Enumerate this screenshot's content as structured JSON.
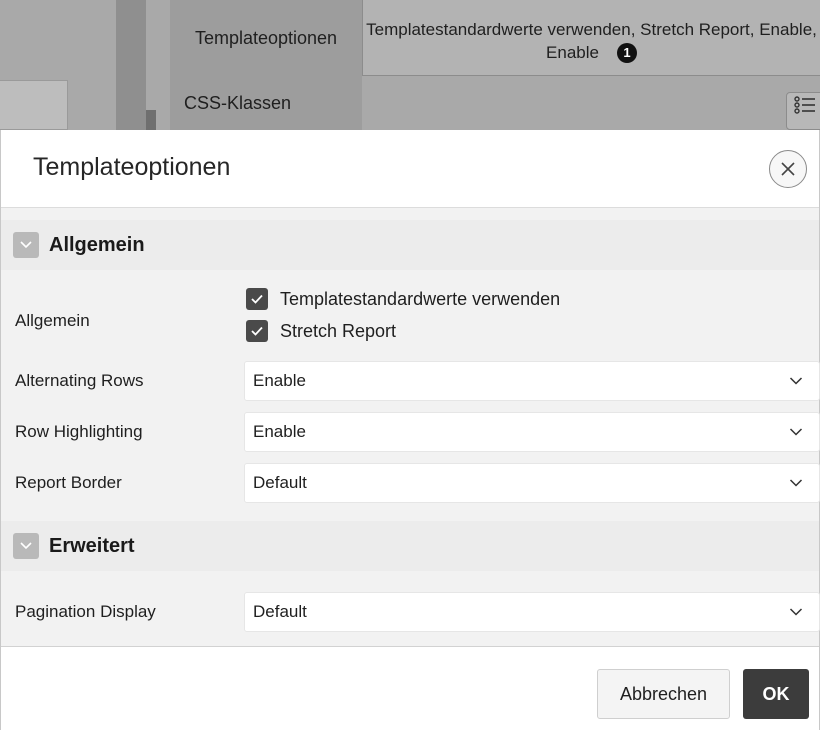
{
  "background": {
    "tabs": [
      {
        "label": "Templateoptionen"
      },
      {
        "label": "Templatestandardwerte verwenden, Stretch Report, Enable, Enable",
        "badge": "1"
      }
    ],
    "css_classes_label": "CSS-Klassen"
  },
  "dialog": {
    "title": "Templateoptionen",
    "close_icon": "close-icon",
    "sections": {
      "general": {
        "title": "Allgemein",
        "group_label": "Allgemein",
        "checkboxes": [
          {
            "label": "Templatestandardwerte verwenden",
            "checked": true
          },
          {
            "label": "Stretch Report",
            "checked": true
          }
        ],
        "fields": [
          {
            "label": "Alternating Rows",
            "value": "Enable"
          },
          {
            "label": "Row Highlighting",
            "value": "Enable"
          },
          {
            "label": "Report Border",
            "value": "Default"
          }
        ]
      },
      "advanced": {
        "title": "Erweitert",
        "fields": [
          {
            "label": "Pagination Display",
            "value": "Default"
          }
        ]
      }
    },
    "buttons": {
      "cancel": "Abbrechen",
      "ok": "OK"
    }
  },
  "colors": {
    "overlay": "#a9a9a9",
    "body_bg": "#f2f2f2",
    "primary_button": "#3c3c3c",
    "checkbox": "#4a4a4a"
  }
}
